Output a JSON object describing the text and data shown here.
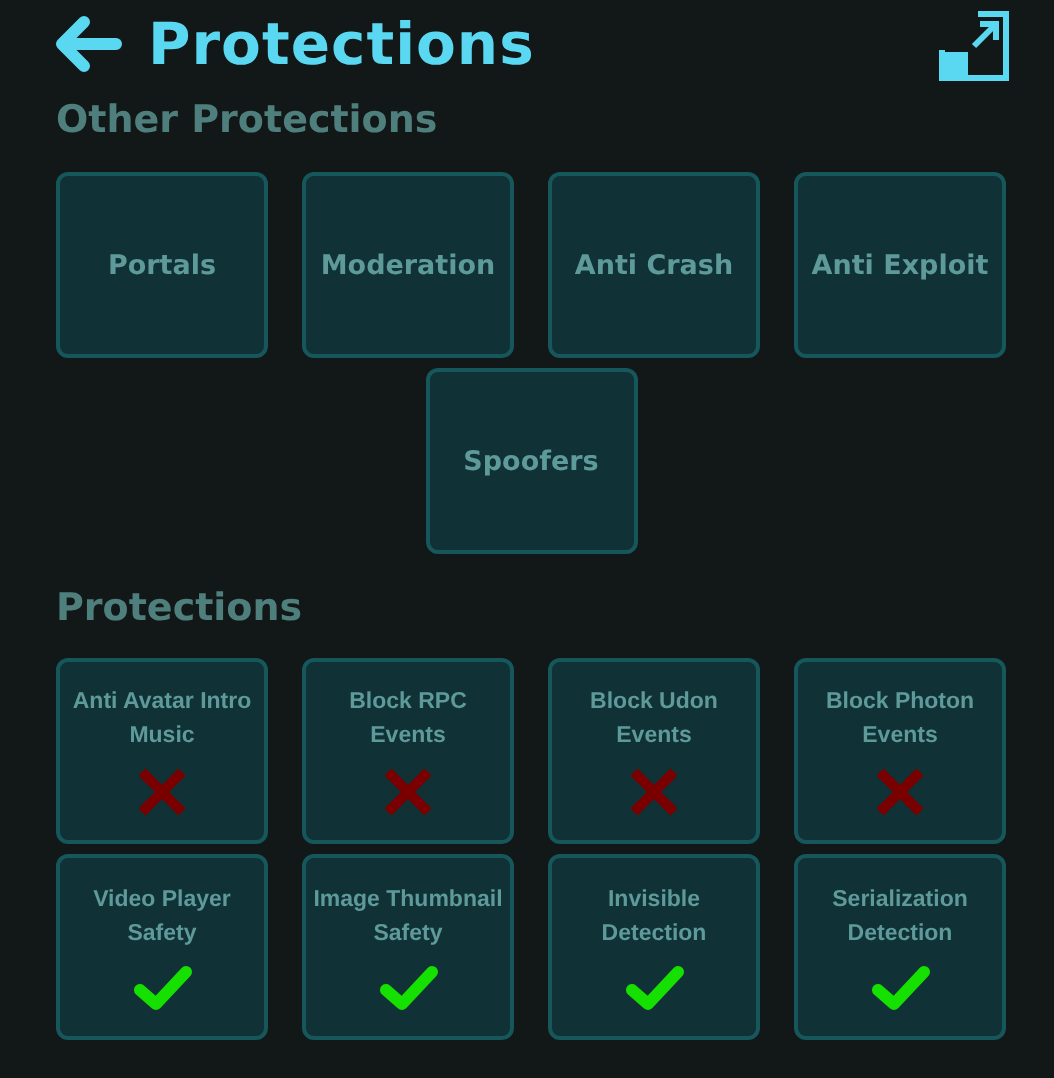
{
  "header": {
    "title": "Protections"
  },
  "other_protections": {
    "title": "Other Protections",
    "buttons": [
      "Portals",
      "Moderation",
      "Anti Crash",
      "Anti Exploit",
      "Spoofers"
    ]
  },
  "protections": {
    "title": "Protections",
    "toggles": [
      {
        "label": "Anti Avatar Intro Music",
        "enabled": false
      },
      {
        "label": "Block RPC Events",
        "enabled": false
      },
      {
        "label": "Block Udon Events",
        "enabled": false
      },
      {
        "label": "Block Photon Events",
        "enabled": false
      },
      {
        "label": "Video Player Safety",
        "enabled": true
      },
      {
        "label": "Image Thumbnail Safety",
        "enabled": true
      },
      {
        "label": "Invisible Detection",
        "enabled": true
      },
      {
        "label": "Serialization Detection",
        "enabled": true
      }
    ]
  }
}
